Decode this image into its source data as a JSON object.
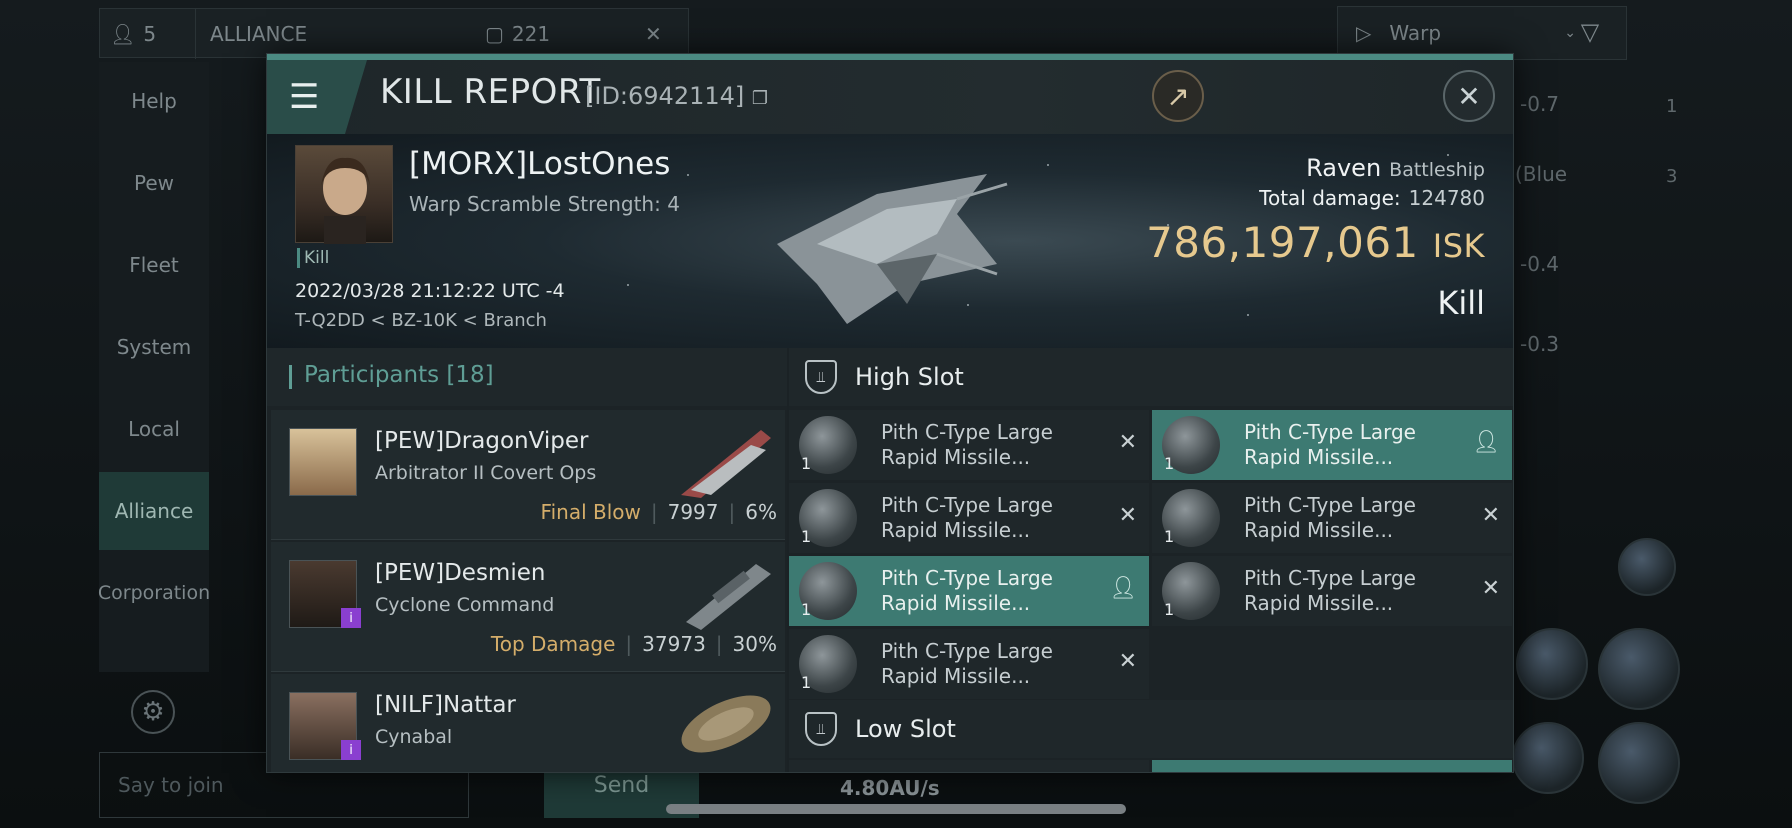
{
  "background": {
    "top_bar": {
      "member_count": "5",
      "channel": "ALLIANCE",
      "message_count": "221"
    },
    "warp_label": "Warp",
    "left_nav": [
      {
        "label": "Help"
      },
      {
        "label": "Pew"
      },
      {
        "label": "Fleet"
      },
      {
        "label": "System"
      },
      {
        "label": "Local"
      },
      {
        "label": "Alliance",
        "active": true
      },
      {
        "label": "Corporation"
      }
    ],
    "chat_placeholder": "Say to join",
    "send_label": "Send",
    "speed": "4.80AU/s",
    "right_values": [
      "-0.7",
      "(Blue",
      "-0.4",
      "-0.3"
    ],
    "right_counts": [
      "1",
      "3"
    ]
  },
  "dialog": {
    "title": "KILL REPORT",
    "report_id": "[ID:6942114]",
    "victim": {
      "name": "[MORX]LostOnes",
      "detail": "Warp Scramble Strength: 4",
      "tag": "Kill",
      "datetime": "2022/03/28 21:12:22 UTC -4",
      "location": "T-Q2DD < BZ-10K < Branch"
    },
    "ship": {
      "name": "Raven",
      "class": "Battleship"
    },
    "total_damage_label": "Total damage:",
    "total_damage": "124780",
    "isk_value": "786,197,061",
    "isk_unit": "ISK",
    "result": "Kill",
    "participants": {
      "label": "Participants",
      "count": "[18]",
      "rows": [
        {
          "name": "[PEW]DragonViper",
          "ship": "Arbitrator II Covert Ops",
          "tag": "Final Blow",
          "damage": "7997",
          "percent": "6%",
          "badge": false
        },
        {
          "name": "[PEW]Desmien",
          "ship": "Cyclone Command",
          "tag": "Top Damage",
          "damage": "37973",
          "percent": "30%",
          "badge": true
        },
        {
          "name": "[NILF]Nattar",
          "ship": "Cynabal",
          "tag": "",
          "damage": "",
          "percent": "",
          "badge": true
        }
      ]
    },
    "high_slot": {
      "label": "High Slot",
      "items": [
        {
          "name_line1": "Pith C-Type Large",
          "name_line2": "Rapid Missile...",
          "qty": "1",
          "action": "destroyed",
          "highlight": false
        },
        {
          "name_line1": "Pith C-Type Large",
          "name_line2": "Rapid Missile...",
          "qty": "1",
          "action": "dropped",
          "highlight": true
        },
        {
          "name_line1": "Pith C-Type Large",
          "name_line2": "Rapid Missile...",
          "qty": "1",
          "action": "destroyed",
          "highlight": false
        },
        {
          "name_line1": "Pith C-Type Large",
          "name_line2": "Rapid Missile...",
          "qty": "1",
          "action": "destroyed",
          "highlight": false
        },
        {
          "name_line1": "Pith C-Type Large",
          "name_line2": "Rapid Missile...",
          "qty": "1",
          "action": "dropped",
          "highlight": true
        },
        {
          "name_line1": "Pith C-Type Large",
          "name_line2": "Rapid Missile...",
          "qty": "1",
          "action": "destroyed",
          "highlight": false
        },
        {
          "name_line1": "Pith C-Type Large",
          "name_line2": "Rapid Missile...",
          "qty": "1",
          "action": "destroyed",
          "highlight": false
        }
      ]
    },
    "low_slot": {
      "label": "Low Slot"
    }
  },
  "icons": {
    "menu": "hamburger-icon",
    "share": "share-icon",
    "close": "close-icon",
    "slot": "slot-icon",
    "destroyed": "x-icon",
    "dropped": "person-icon",
    "settings": "gear-icon",
    "filter": "filter-icon"
  },
  "colors": {
    "accent": "#4b8a82",
    "isk": "#e6c98e",
    "final_blow": "#d4ad6a",
    "participants": "#5f9e95"
  }
}
